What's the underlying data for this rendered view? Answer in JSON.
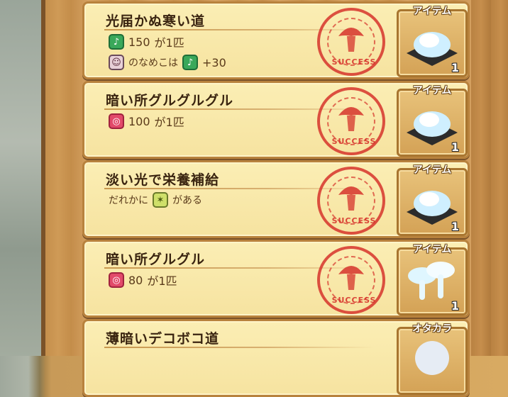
{
  "missions": [
    {
      "title": "光届かぬ寒い道",
      "cond_amount": "150",
      "cond_text": "が1匹",
      "bonus_prefix": "のなめこは",
      "bonus_value": "+30",
      "stamp_text": "SUCCESS",
      "reward_label": "アイテム",
      "reward_qty": "1"
    },
    {
      "title": "暗い所グルグルグル",
      "cond_amount": "100",
      "cond_text": "が1匹",
      "stamp_text": "SUCCESS",
      "reward_label": "アイテム",
      "reward_qty": "1"
    },
    {
      "title": "淡い光で栄養補給",
      "cond_prefix": "だれかに",
      "cond_text": "がある",
      "stamp_text": "SUCCESS",
      "reward_label": "アイテム",
      "reward_qty": "1"
    },
    {
      "title": "暗い所グルグル",
      "cond_amount": "80",
      "cond_text": "が1匹",
      "stamp_text": "SUCCESS",
      "reward_label": "アイテム",
      "reward_qty": "1"
    },
    {
      "title": "薄暗いデコボコ道",
      "reward_label": "オタカラ"
    }
  ],
  "colors": {
    "stamp": "#d6342c",
    "card": "#f6e3a0",
    "frame": "#a8752f"
  }
}
